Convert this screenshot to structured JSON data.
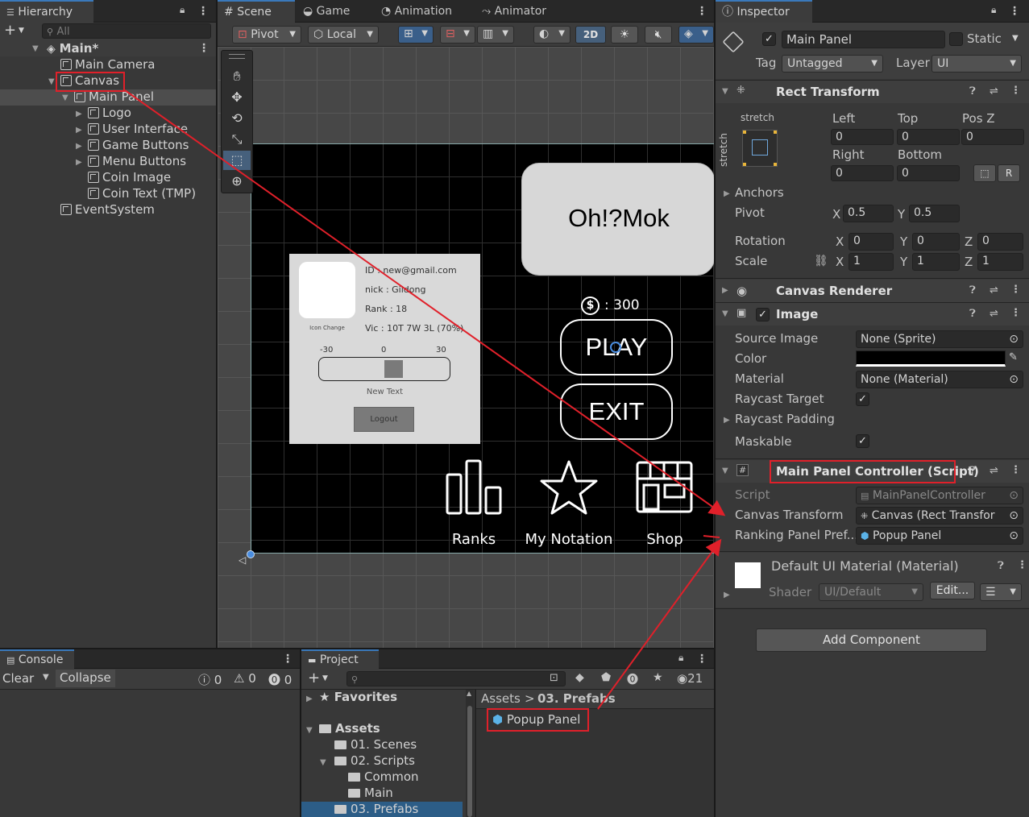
{
  "hierarchy": {
    "tab": "Hierarchy",
    "search_placeholder": "All",
    "scene": "Main*",
    "items": [
      "Main Camera",
      "Canvas",
      "Main Panel",
      "Logo",
      "User Interface",
      "Game Buttons",
      "Menu Buttons",
      "Coin Image",
      "Coin Text (TMP)",
      "EventSystem"
    ]
  },
  "scene_view": {
    "tabs": [
      "Scene",
      "Game",
      "Animation",
      "Animator"
    ],
    "toolbar": {
      "pivot": "Pivot",
      "local": "Local",
      "mode_2d": "2D"
    },
    "game": {
      "title": "Oh!?Mok",
      "coins": ": 300",
      "coin_symbol": "$",
      "play": "PLAY",
      "exit": "EXIT",
      "profile": {
        "id": "ID : new@gmail.com",
        "nick": "nick : Gildong",
        "rank": "Rank : 18",
        "vic": "Vic : 10T 7W 3L (70%)",
        "icon_change": "Icon Change",
        "slider_min": "-30",
        "slider_mid": "0",
        "slider_max": "30",
        "new_text": "New Text",
        "logout": "Logout"
      },
      "menu": [
        "Ranks",
        "My Notation",
        "Shop"
      ]
    }
  },
  "inspector": {
    "tab": "Inspector",
    "object_name": "Main Panel",
    "static_label": "Static",
    "tag_label": "Tag",
    "tag_value": "Untagged",
    "layer_label": "Layer",
    "layer_value": "UI",
    "rect_transform": {
      "title": "Rect Transform",
      "stretch_top": "stretch",
      "stretch_side": "stretch",
      "left_label": "Left",
      "left": "0",
      "top_label": "Top",
      "top": "0",
      "posz_label": "Pos Z",
      "posz": "0",
      "right_label": "Right",
      "right": "0",
      "bottom_label": "Bottom",
      "bottom": "0",
      "anchors": "Anchors",
      "pivot_label": "Pivot",
      "pivot_x": "0.5",
      "pivot_y": "0.5",
      "rotation_label": "Rotation",
      "rot_x": "0",
      "rot_y": "0",
      "rot_z": "0",
      "scale_label": "Scale",
      "scale_x": "1",
      "scale_y": "1",
      "scale_z": "1",
      "x": "X",
      "y": "Y",
      "z": "Z",
      "r_btn": "R"
    },
    "canvas_renderer": "Canvas Renderer",
    "image": {
      "title": "Image",
      "source_image_label": "Source Image",
      "source_image": "None (Sprite)",
      "color_label": "Color",
      "material_label": "Material",
      "material": "None (Material)",
      "raycast_target": "Raycast Target",
      "raycast_padding": "Raycast Padding",
      "maskable": "Maskable"
    },
    "controller": {
      "title": "Main Panel Controller (Script)",
      "script_label": "Script",
      "script": "MainPanelController",
      "canvas_transform_label": "Canvas Transform",
      "canvas_transform": "Canvas (Rect Transfor",
      "ranking_label": "Ranking Panel Pref...",
      "ranking": "Popup Panel"
    },
    "material_block": {
      "title": "Default UI Material (Material)",
      "shader_label": "Shader",
      "shader": "UI/Default",
      "edit": "Edit..."
    },
    "add_component": "Add Component"
  },
  "console": {
    "tab": "Console",
    "clear": "Clear",
    "collapse": "Collapse",
    "counts": [
      "0",
      "0",
      "0"
    ]
  },
  "project": {
    "tab": "Project",
    "hidden_count": "21",
    "favorites": "Favorites",
    "assets": "Assets",
    "folders": [
      "01. Scenes",
      "02. Scripts",
      "Common",
      "Main",
      "03. Prefabs"
    ],
    "breadcrumb_root": "Assets",
    "breadcrumb_sep": ">",
    "breadcrumb_current": "03. Prefabs",
    "prefab": "Popup Panel"
  }
}
